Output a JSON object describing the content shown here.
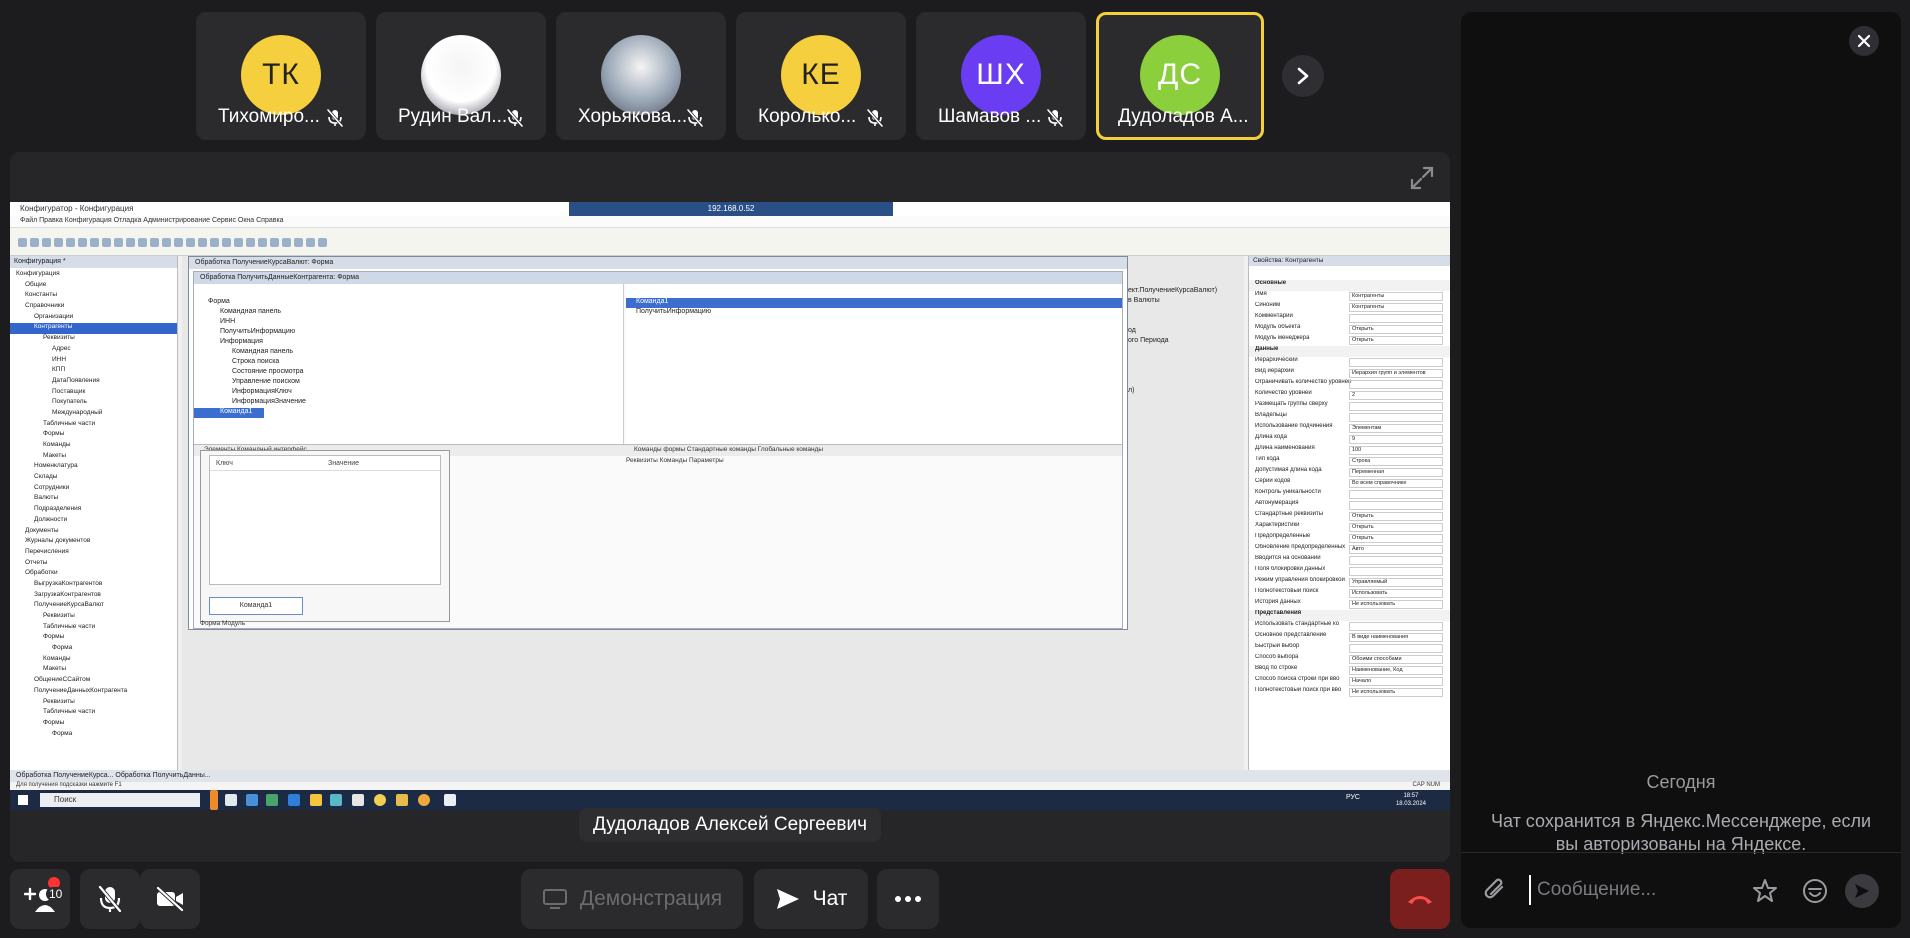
{
  "participants": [
    {
      "initials": "ТК",
      "name": "Тихомиро...",
      "color": "#f5cf3d",
      "text_color": "#222222",
      "muted": true,
      "photo": false
    },
    {
      "initials": "",
      "name": "Рудин Вал...",
      "color": "#ffffff",
      "text_color": "#222222",
      "muted": true,
      "photo": true
    },
    {
      "initials": "",
      "name": "Хорьякова...",
      "color": "#9aa7b6",
      "text_color": "#222222",
      "muted": true,
      "photo": true
    },
    {
      "initials": "КЕ",
      "name": "Королько...",
      "color": "#f5cf3d",
      "text_color": "#222222",
      "muted": true,
      "photo": false
    },
    {
      "initials": "ШХ",
      "name": "Шамавов ...",
      "color": "#6a3cf2",
      "text_color": "#ffffff",
      "muted": true,
      "photo": false
    },
    {
      "initials": "ДС",
      "name": "Дудоладов А...",
      "color": "#8ccf3c",
      "text_color": "#ffffff",
      "muted": false,
      "photo": false,
      "active": true
    }
  ],
  "stage": {
    "presenter_name": "Дудоладов Алексей Сергеевич"
  },
  "shared_screen": {
    "window_title": "Конфигуратор - Конфигурация",
    "rdp_address": "192.168.0.52",
    "menu": "Файл  Правка  Конфигурация  Отладка  Администрирование  Сервис  Окна  Справка",
    "config_header": "Конфигурация *",
    "tree": [
      "Конфигурация",
      "Общие",
      "Константы",
      "Справочники",
      "Организации",
      "Контрагенты",
      "Реквизиты",
      "Адрес",
      "ИНН",
      "КПП",
      "ДатаПоявления",
      "Поставщик",
      "Покупатель",
      "Международный",
      "Табличные части",
      "Формы",
      "Команды",
      "Макеты",
      "Номенклатура",
      "Склады",
      "Сотрудники",
      "Валюты",
      "Подразделения",
      "Должности",
      "Документы",
      "Журналы документов",
      "Перечисления",
      "Отчеты",
      "Обработки",
      "ВыгрузкаКонтрагентов",
      "ЗагрузкаКонтрагентов",
      "ПолучениеКурсаВалют",
      "Реквизиты",
      "Табличные части",
      "Формы",
      "Форма",
      "Команды",
      "Макеты",
      "ОбщениеССайтом",
      "ПолучениеДанныхКонтрагента",
      "Реквизиты",
      "Табличные части",
      "Формы",
      "Форма"
    ],
    "tree_selected_index": 5,
    "outer_form_title": "Обработка ПолучениеКурсаВалют: Форма",
    "inner_form_title": "Обработка ПолучитьДанныеКонтрагента: Форма",
    "elements": [
      "Форма",
      "Командная панель",
      "ИНН",
      "ПолучитьИнформацию",
      "Информация",
      "Командная панель",
      "Строка поиска",
      "Состояние просмотра",
      "Управление поиском",
      "ИнформацияКлюч",
      "ИнформацияЗначение",
      "Команда1"
    ],
    "commands": [
      "Команда1",
      "ПолучитьИнформацию"
    ],
    "tabs_elements": "Элементы    Командный интерфейс",
    "tabs_commands": "Команды формы    Стандартные команды    Глобальные команды",
    "tabs_bottom": "Реквизиты    Команды    Параметры",
    "preview_col_key": "Ключ",
    "preview_col_value": "Значение",
    "preview_button": "Команда1",
    "preview_tabs": "Форма    Модуль",
    "code_lines": [
      "ект.ПолучениеКурсаВалют)",
      "в Валюты",
      "",
      "",
      "од",
      "ого Периода",
      "",
      "",
      "",
      "",
      "л)"
    ],
    "props_header": "Свойства: Контрагенты",
    "props": [
      {
        "label": "Основные",
        "value": "",
        "section": true
      },
      {
        "label": "Имя",
        "value": "Контрагенты"
      },
      {
        "label": "Синоним",
        "value": "Контрагенты"
      },
      {
        "label": "Комментарий",
        "value": ""
      },
      {
        "label": "Модуль объекта",
        "value": "Открыть"
      },
      {
        "label": "Модуль менеджера",
        "value": "Открыть"
      },
      {
        "label": "Данные",
        "value": "",
        "section": true
      },
      {
        "label": "Иерархический",
        "value": ""
      },
      {
        "label": "Вид иерархии",
        "value": "Иерархия групп и элементов"
      },
      {
        "label": "Ограничивать количество уровней",
        "value": ""
      },
      {
        "label": "Количество уровней",
        "value": "2"
      },
      {
        "label": "Размещать группы сверху",
        "value": ""
      },
      {
        "label": "Владельцы",
        "value": ""
      },
      {
        "label": "Использование подчинения",
        "value": "Элементам"
      },
      {
        "label": "Длина кода",
        "value": "9"
      },
      {
        "label": "Длина наименования",
        "value": "100"
      },
      {
        "label": "Тип кода",
        "value": "Строка"
      },
      {
        "label": "Допустимая длина кода",
        "value": "Переменная"
      },
      {
        "label": "Серии кодов",
        "value": "Во всем справочнике"
      },
      {
        "label": "Контроль уникальности",
        "value": ""
      },
      {
        "label": "Автонумерация",
        "value": ""
      },
      {
        "label": "Стандартные реквизиты",
        "value": "Открыть"
      },
      {
        "label": "Характеристики",
        "value": "Открыть"
      },
      {
        "label": "Предопределенные",
        "value": "Открыть"
      },
      {
        "label": "Обновление предопределенных",
        "value": "Авто"
      },
      {
        "label": "Вводится на основании",
        "value": ""
      },
      {
        "label": "Поля блокировки данных",
        "value": ""
      },
      {
        "label": "Режим управления блокировкой",
        "value": "Управляемый"
      },
      {
        "label": "Полнотекстовый поиск",
        "value": "Использовать"
      },
      {
        "label": "История данных",
        "value": "Не использовать"
      },
      {
        "label": "Представления",
        "value": "",
        "section": true
      },
      {
        "label": "Использовать стандартные ко",
        "value": ""
      },
      {
        "label": "Основное представление",
        "value": "В виде наименования"
      },
      {
        "label": "Быстрый выбор",
        "value": ""
      },
      {
        "label": "Способ выбора",
        "value": "Обоими способами"
      },
      {
        "label": "Ввод по строке",
        "value": "Наименование, Код"
      },
      {
        "label": "Способ поиска строки при вво",
        "value": "Начало"
      },
      {
        "label": "Полнотекстовый поиск при вво",
        "value": "Не использовать"
      }
    ],
    "status_tabs": "Обработка ПолучениеКурса...   Обработка ПолучитьДанны...",
    "status_hint": "Для получения подсказки нажмите F1",
    "status_right": "CAP  NUM",
    "taskbar_search": "Поиск",
    "clock_time": "18:57",
    "clock_date": "18.03.2024",
    "lang": "РУС"
  },
  "chat": {
    "today_label": "Сегодня",
    "note": "Чат сохранится в Яндекс.Мессенджере, если вы авторизованы на Яндексе.",
    "input_placeholder": "Сообщение..."
  },
  "toolbar": {
    "participants_count": "10",
    "demo_label": "Демонстрация",
    "chat_label": "Чат"
  }
}
